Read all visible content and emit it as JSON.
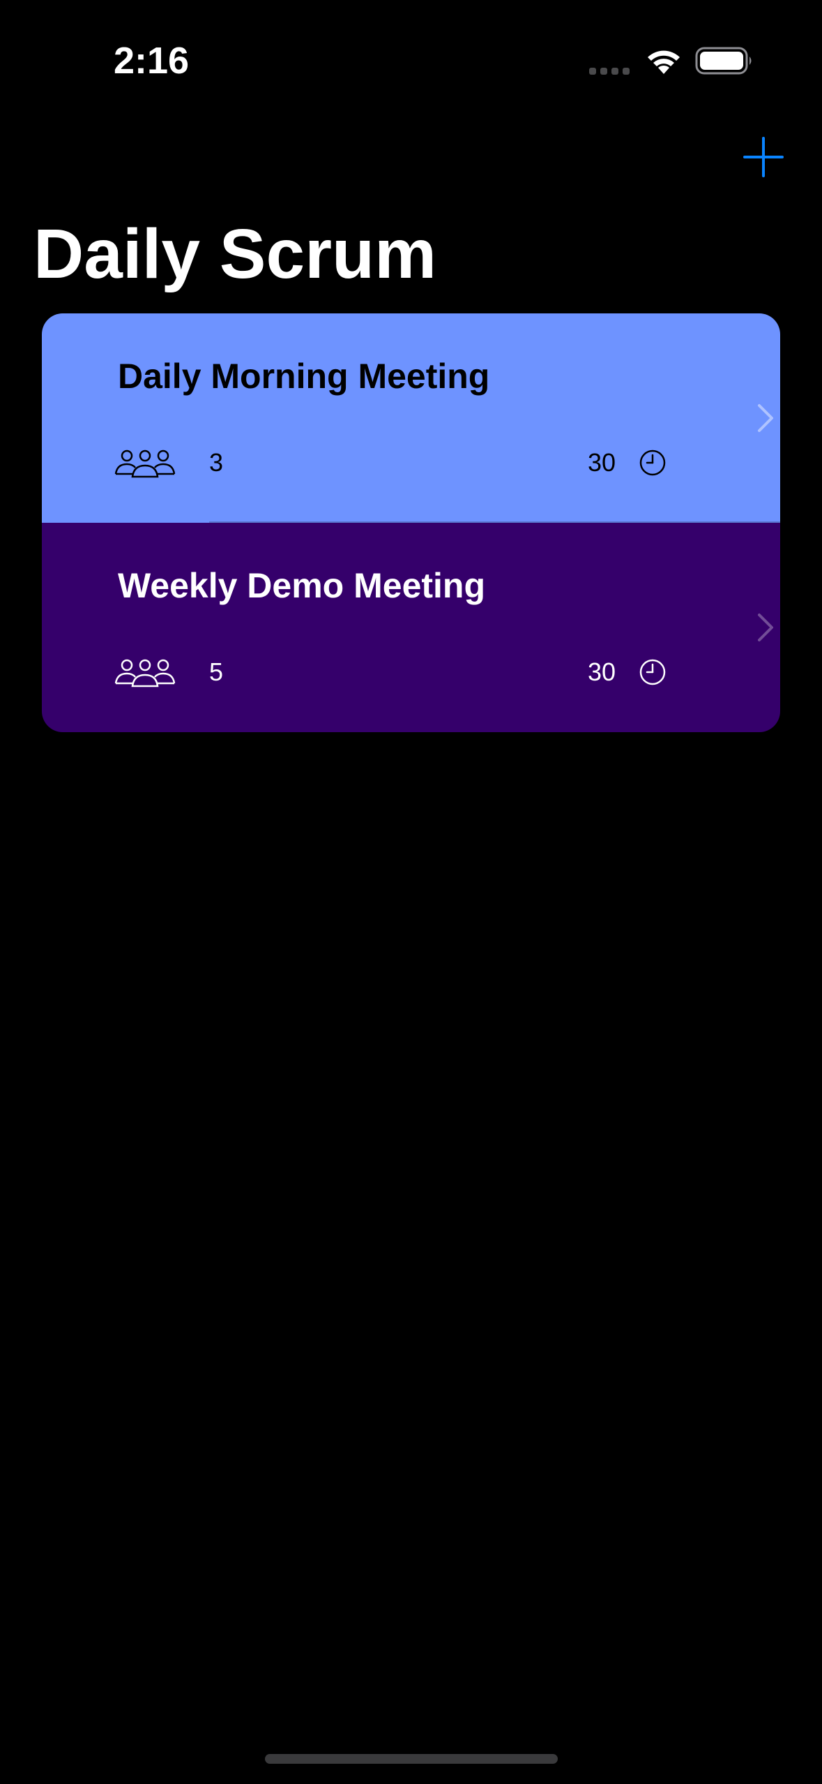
{
  "status_bar": {
    "time": "2:16"
  },
  "nav": {
    "add_icon": "plus-icon",
    "accent_color": "#0A84FF"
  },
  "page": {
    "title": "Daily Scrum"
  },
  "scrums": [
    {
      "title": "Daily Morning Meeting",
      "attendees": "3",
      "duration": "30",
      "theme_color": "#6E93FF",
      "text_color": "#000000"
    },
    {
      "title": "Weekly Demo Meeting",
      "attendees": "5",
      "duration": "30",
      "theme_color": "#35006B",
      "text_color": "#FFFFFF"
    }
  ]
}
